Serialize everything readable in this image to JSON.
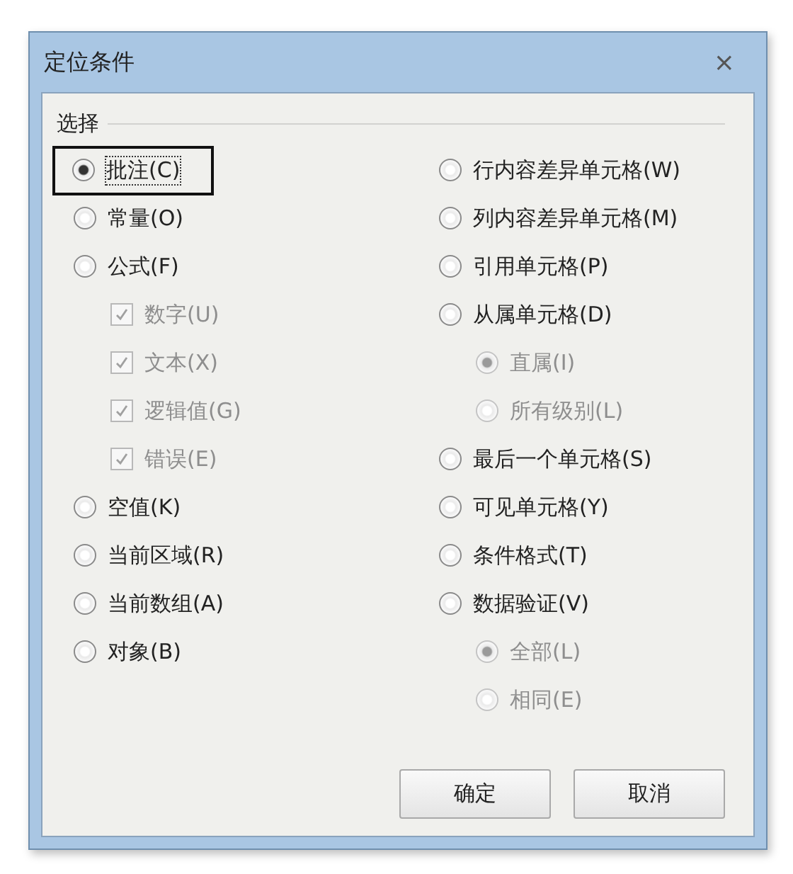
{
  "window": {
    "title": "定位条件",
    "close": "×"
  },
  "group": {
    "label": "选择",
    "left": [
      {
        "kind": "radio",
        "label": "批注(C)",
        "selected": true,
        "disabled": false,
        "focused": true
      },
      {
        "kind": "radio",
        "label": "常量(O)",
        "selected": false,
        "disabled": false,
        "focused": false
      },
      {
        "kind": "radio",
        "label": "公式(F)",
        "selected": false,
        "disabled": false,
        "focused": false,
        "children": [
          {
            "kind": "checkbox",
            "label": "数字(U)",
            "checked": true,
            "disabled": true,
            "focused": false
          },
          {
            "kind": "checkbox",
            "label": "文本(X)",
            "checked": true,
            "disabled": true,
            "focused": false
          },
          {
            "kind": "checkbox",
            "label": "逻辑值(G)",
            "checked": true,
            "disabled": true,
            "focused": false
          },
          {
            "kind": "checkbox",
            "label": "错误(E)",
            "checked": true,
            "disabled": true,
            "focused": false
          }
        ]
      },
      {
        "kind": "radio",
        "label": "空值(K)",
        "selected": false,
        "disabled": false,
        "focused": false
      },
      {
        "kind": "radio",
        "label": "当前区域(R)",
        "selected": false,
        "disabled": false,
        "focused": false
      },
      {
        "kind": "radio",
        "label": "当前数组(A)",
        "selected": false,
        "disabled": false,
        "focused": false
      },
      {
        "kind": "radio",
        "label": "对象(B)",
        "selected": false,
        "disabled": false,
        "focused": false
      }
    ],
    "right": [
      {
        "kind": "radio",
        "label": "行内容差异单元格(W)",
        "selected": false,
        "disabled": false,
        "focused": false
      },
      {
        "kind": "radio",
        "label": "列内容差异单元格(M)",
        "selected": false,
        "disabled": false,
        "focused": false
      },
      {
        "kind": "radio",
        "label": "引用单元格(P)",
        "selected": false,
        "disabled": false,
        "focused": false
      },
      {
        "kind": "radio",
        "label": "从属单元格(D)",
        "selected": false,
        "disabled": false,
        "focused": false,
        "children": [
          {
            "kind": "radio",
            "label": "直属(I)",
            "selected": true,
            "disabled": true,
            "focused": false
          },
          {
            "kind": "radio",
            "label": "所有级别(L)",
            "selected": false,
            "disabled": true,
            "focused": false
          }
        ]
      },
      {
        "kind": "radio",
        "label": "最后一个单元格(S)",
        "selected": false,
        "disabled": false,
        "focused": false
      },
      {
        "kind": "radio",
        "label": "可见单元格(Y)",
        "selected": false,
        "disabled": false,
        "focused": false
      },
      {
        "kind": "radio",
        "label": "条件格式(T)",
        "selected": false,
        "disabled": false,
        "focused": false
      },
      {
        "kind": "radio",
        "label": "数据验证(V)",
        "selected": false,
        "disabled": false,
        "focused": false,
        "children": [
          {
            "kind": "radio",
            "label": "全部(L)",
            "selected": true,
            "disabled": true,
            "focused": false
          },
          {
            "kind": "radio",
            "label": "相同(E)",
            "selected": false,
            "disabled": true,
            "focused": false
          }
        ]
      }
    ]
  },
  "buttons": [
    "确定",
    "取消"
  ]
}
